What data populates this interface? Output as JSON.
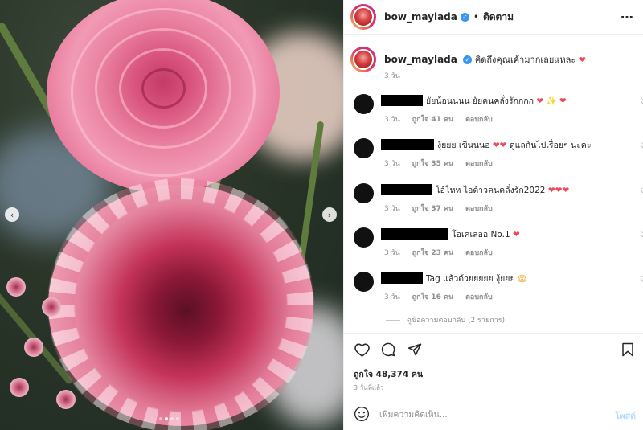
{
  "post": {
    "username": "bow_maylada",
    "follow_label": "ติดตาม",
    "more_icon": "⋯",
    "verified_icon": "✓"
  },
  "caption": {
    "username": "bow_maylada",
    "text": "คิดถึงคุณเค้ามากเลยแหละ",
    "emoji": "❤",
    "time": "3 วัน"
  },
  "comments": [
    {
      "text": "ยัยน้อนนนน ยัยคนคลั่งรักกกก",
      "emoji": "❤ ✨ ❤",
      "time": "3 วัน",
      "likes": "ถูกใจ 41 คน",
      "reply": "ตอบกลับ"
    },
    {
      "text": "งุ้ยยย เขินนนอ",
      "emoji_mid": "❤❤",
      "text2": "ดูแลกันไปเรื่อยๆ นะคะ",
      "time": "3 วัน",
      "likes": "ถูกใจ 35 คน",
      "reply": "ตอบกลับ"
    },
    {
      "text": "โอ้โหห ไอต้าวคนคลั่งรัก2022",
      "emoji": "❤❤❤",
      "time": "3 วัน",
      "likes": "ถูกใจ 37 คน",
      "reply": "ตอบกลับ"
    },
    {
      "text": "โอเคเลออ No.1",
      "emoji": "❤",
      "time": "3 วัน",
      "likes": "ถูกใจ 23 คน",
      "reply": "ตอบกลับ"
    },
    {
      "text": "Tag แล้วด้วยยยยย งุ้ยยย",
      "emoji": "😱",
      "time": "3 วัน",
      "likes": "ถูกใจ 16 คน",
      "reply": "ตอบกลับ"
    }
  ],
  "view_replies": "ดูข้อความตอบกลับ (2 รายการ)",
  "likes_total": "ถูกใจ 48,374 คน",
  "post_time": "3 วันที่แล้ว",
  "comment_box": {
    "placeholder": "เพิ่มความคิดเห็น...",
    "post_label": "โพสต์"
  },
  "carousel": {
    "prev": "‹",
    "next": "›",
    "slide_count": 4,
    "active_slide": 2
  }
}
